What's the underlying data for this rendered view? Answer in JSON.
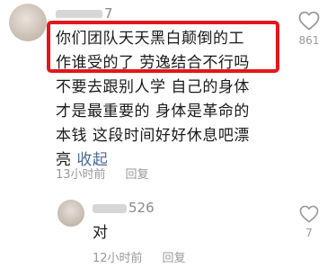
{
  "main_comment": {
    "username": "7",
    "text_lines": [
      "你们团队天天黑白颠倒的工",
      "作谁受的了 劳逸结合不行吗",
      "不要去跟别人学 自己的身体",
      "才是最重要的 身体是革命的",
      "本钱 这段时间好好休息吧漂"
    ],
    "text_last": "亮",
    "collapse_label": "收起",
    "time": "13小时前",
    "reply_label": "回复",
    "like_count": "861",
    "like_icon": "heart-outline-icon"
  },
  "reply_comment": {
    "username": "526",
    "text": "对",
    "time": "12小时前",
    "reply_label": "回复",
    "like_count": "7",
    "like_icon": "heart-outline-icon"
  },
  "colors": {
    "highlight_border": "#e3161c",
    "collapse_link": "#4a6a9c",
    "meta_text": "#999999"
  }
}
